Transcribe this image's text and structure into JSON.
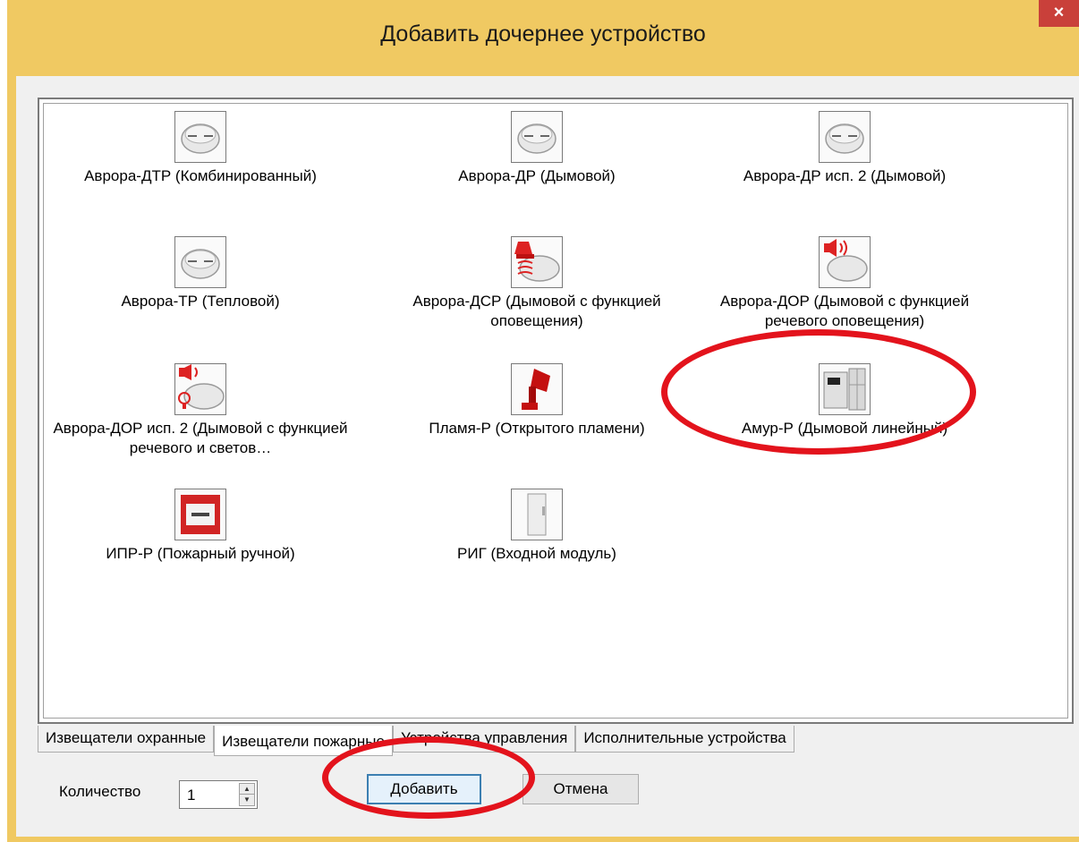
{
  "window": {
    "title": "Добавить дочернее устройство",
    "close_glyph": "×"
  },
  "devices": [
    {
      "label": "Аврора-ДТР (Комбинированный)",
      "icon": "smoke-detector-icon"
    },
    {
      "label": "Аврора-ДР (Дымовой)",
      "icon": "smoke-detector-icon"
    },
    {
      "label": "Аврора-ДР исп. 2 (Дымовой)",
      "icon": "smoke-detector-icon"
    },
    {
      "label": "Аврора-ТР (Тепловой)",
      "icon": "smoke-detector-icon"
    },
    {
      "label": "Аврора-ДСР (Дымовой с функцией оповещения)",
      "icon": "smoke-detector-siren-icon"
    },
    {
      "label": "Аврора-ДОР (Дымовой с функцией речевого оповещения)",
      "icon": "smoke-detector-speaker-icon"
    },
    {
      "label": "Аврора-ДОР исп. 2 (Дымовой с функцией речевого и светов…",
      "icon": "smoke-detector-speaker-light-icon"
    },
    {
      "label": "Пламя-Р (Открытого пламени)",
      "icon": "flame-detector-icon"
    },
    {
      "label": "Амур-Р (Дымовой линейный)",
      "icon": "linear-smoke-detector-icon"
    },
    {
      "label": "ИПР-Р (Пожарный ручной)",
      "icon": "manual-call-point-icon"
    },
    {
      "label": "РИГ (Входной модуль)",
      "icon": "input-module-icon"
    }
  ],
  "tabs": [
    {
      "label": "Извещатели охранные"
    },
    {
      "label": "Извещатели пожарные"
    },
    {
      "label": "Устройства управления"
    },
    {
      "label": "Исполнительные устройства"
    }
  ],
  "active_tab": "Извещатели пожарные",
  "quantity": {
    "label": "Количество",
    "value": "1"
  },
  "buttons": {
    "add": "Добавить",
    "cancel": "Отмена"
  },
  "colors": {
    "titlebar": "#f0c962",
    "close": "#c9403a",
    "highlight": "#e3131c"
  }
}
